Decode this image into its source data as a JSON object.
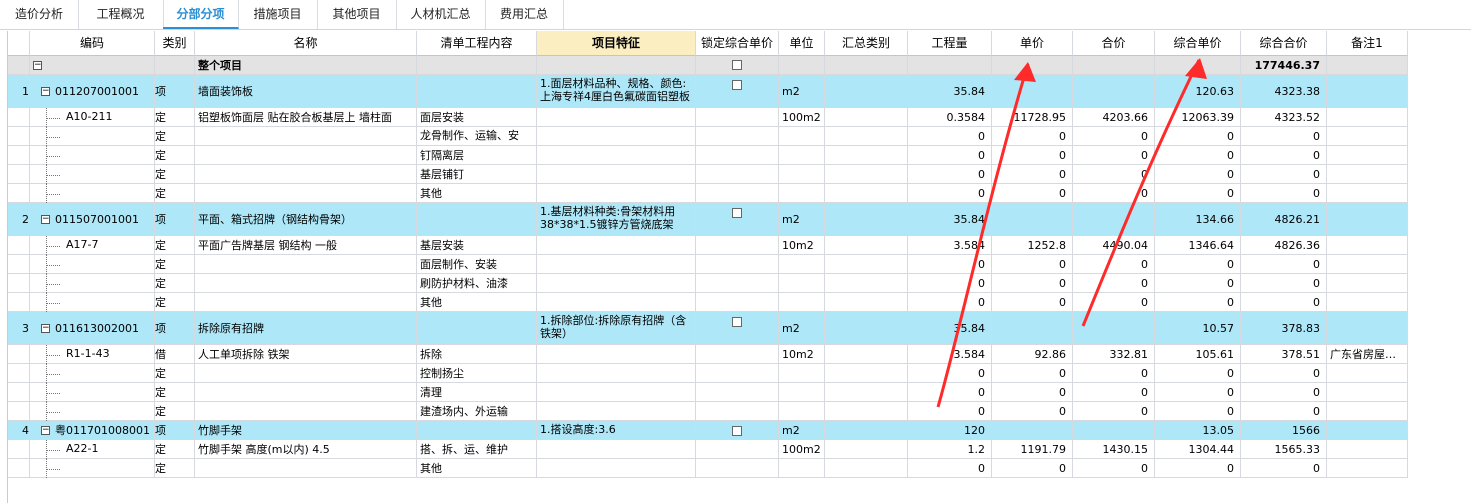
{
  "tabs": [
    "造价分析",
    "工程概况",
    "分部分项",
    "措施项目",
    "其他项目",
    "人材机汇总",
    "费用汇总"
  ],
  "active_tab": "分部分项",
  "columns": [
    "编码",
    "类别",
    "名称",
    "清单工程内容",
    "项目特征",
    "锁定综合单价",
    "单位",
    "汇总类别",
    "工程量",
    "单价",
    "合价",
    "综合单价",
    "综合合价",
    "备注1"
  ],
  "total_row": {
    "name": "整个项目",
    "toggle": "−",
    "total": "177446.37"
  },
  "rows": [
    {
      "kind": "item",
      "no": "1",
      "code": "011207001001",
      "type": "项",
      "name": "墙面装饰板",
      "content": "",
      "feature": "1.面层材料品种、规格、颜色:上海专祥4厘白色氟碳面铝塑板",
      "unit": "m2",
      "qty": "35.84",
      "price": "",
      "amount": "",
      "unit_total": "120.63",
      "total": "4323.38",
      "note": ""
    },
    {
      "kind": "quota",
      "code": "A10-211",
      "type": "定",
      "name": "铝塑板饰面层 贴在胶合板基层上 墙柱面",
      "content": "面层安装",
      "unit": "100m2",
      "qty": "0.3584",
      "price": "11728.95",
      "amount": "4203.66",
      "unit_total": "12063.39",
      "total": "4323.52",
      "note": ""
    },
    {
      "kind": "sub",
      "code": "",
      "type": "定",
      "name": "",
      "content": "龙骨制作、运输、安",
      "unit": "",
      "qty": "0",
      "price": "0",
      "amount": "0",
      "unit_total": "0",
      "total": "0",
      "note": ""
    },
    {
      "kind": "sub",
      "code": "",
      "type": "定",
      "name": "",
      "content": "钉隔离层",
      "unit": "",
      "qty": "0",
      "price": "0",
      "amount": "0",
      "unit_total": "0",
      "total": "0",
      "note": ""
    },
    {
      "kind": "sub",
      "code": "",
      "type": "定",
      "name": "",
      "content": "基层铺钉",
      "unit": "",
      "qty": "0",
      "price": "0",
      "amount": "0",
      "unit_total": "0",
      "total": "0",
      "note": ""
    },
    {
      "kind": "sub",
      "code": "",
      "type": "定",
      "name": "",
      "content": "其他",
      "unit": "",
      "qty": "0",
      "price": "0",
      "amount": "0",
      "unit_total": "0",
      "total": "0",
      "note": ""
    },
    {
      "kind": "item",
      "no": "2",
      "code": "011507001001",
      "type": "项",
      "name": "平面、箱式招牌（钢结构骨架）",
      "content": "",
      "feature": "1.基层材料种类:骨架材料用38*38*1.5镀锌方管烧底架",
      "unit": "m2",
      "qty": "35.84",
      "price": "",
      "amount": "",
      "unit_total": "134.66",
      "total": "4826.21",
      "note": ""
    },
    {
      "kind": "quota",
      "code": "A17-7",
      "type": "定",
      "name": "平面广告牌基层 钢结构 一般",
      "content": "基层安装",
      "unit": "10m2",
      "qty": "3.584",
      "price": "1252.8",
      "amount": "4490.04",
      "unit_total": "1346.64",
      "total": "4826.36",
      "note": ""
    },
    {
      "kind": "sub",
      "code": "",
      "type": "定",
      "name": "",
      "content": "面层制作、安装",
      "unit": "",
      "qty": "0",
      "price": "0",
      "amount": "0",
      "unit_total": "0",
      "total": "0",
      "note": ""
    },
    {
      "kind": "sub",
      "code": "",
      "type": "定",
      "name": "",
      "content": "刷防护材料、油漆",
      "unit": "",
      "qty": "0",
      "price": "0",
      "amount": "0",
      "unit_total": "0",
      "total": "0",
      "note": ""
    },
    {
      "kind": "sub",
      "code": "",
      "type": "定",
      "name": "",
      "content": "其他",
      "unit": "",
      "qty": "0",
      "price": "0",
      "amount": "0",
      "unit_total": "0",
      "total": "0",
      "note": ""
    },
    {
      "kind": "item",
      "no": "3",
      "code": "011613002001",
      "type": "项",
      "name": "拆除原有招牌",
      "content": "",
      "feature": "1.拆除部位:拆除原有招牌（含铁架）",
      "unit": "m2",
      "qty": "35.84",
      "price": "",
      "amount": "",
      "unit_total": "10.57",
      "total": "378.83",
      "note": ""
    },
    {
      "kind": "quota",
      "code": "R1-1-43",
      "type": "借",
      "name": "人工单项拆除 铁架",
      "content": "拆除",
      "unit": "10m2",
      "qty": "3.584",
      "price": "92.86",
      "amount": "332.81",
      "unit_total": "105.61",
      "total": "378.51",
      "note": "广东省房屋…"
    },
    {
      "kind": "sub",
      "code": "",
      "type": "定",
      "name": "",
      "content": "控制扬尘",
      "unit": "",
      "qty": "0",
      "price": "0",
      "amount": "0",
      "unit_total": "0",
      "total": "0",
      "note": ""
    },
    {
      "kind": "sub",
      "code": "",
      "type": "定",
      "name": "",
      "content": "清理",
      "unit": "",
      "qty": "0",
      "price": "0",
      "amount": "0",
      "unit_total": "0",
      "total": "0",
      "note": ""
    },
    {
      "kind": "sub",
      "code": "",
      "type": "定",
      "name": "",
      "content": "建渣场内、外运输",
      "unit": "",
      "qty": "0",
      "price": "0",
      "amount": "0",
      "unit_total": "0",
      "total": "0",
      "note": ""
    },
    {
      "kind": "item",
      "no": "4",
      "code": "粤011701008001",
      "type": "项",
      "name": "竹脚手架",
      "content": "",
      "feature": "1.搭设高度:3.6",
      "unit": "m2",
      "qty": "120",
      "price": "",
      "amount": "",
      "unit_total": "13.05",
      "total": "1566",
      "note": ""
    },
    {
      "kind": "quota",
      "code": "A22-1",
      "type": "定",
      "name": "竹脚手架 高度(m以内) 4.5",
      "content": "搭、拆、运、维护",
      "unit": "100m2",
      "qty": "1.2",
      "price": "1191.79",
      "amount": "1430.15",
      "unit_total": "1304.44",
      "total": "1565.33",
      "note": ""
    },
    {
      "kind": "sub",
      "code": "",
      "type": "定",
      "name": "",
      "content": "其他",
      "unit": "",
      "qty": "0",
      "price": "0",
      "amount": "0",
      "unit_total": "0",
      "total": "0",
      "note": ""
    }
  ],
  "annotation_color": "#ff2a2a"
}
